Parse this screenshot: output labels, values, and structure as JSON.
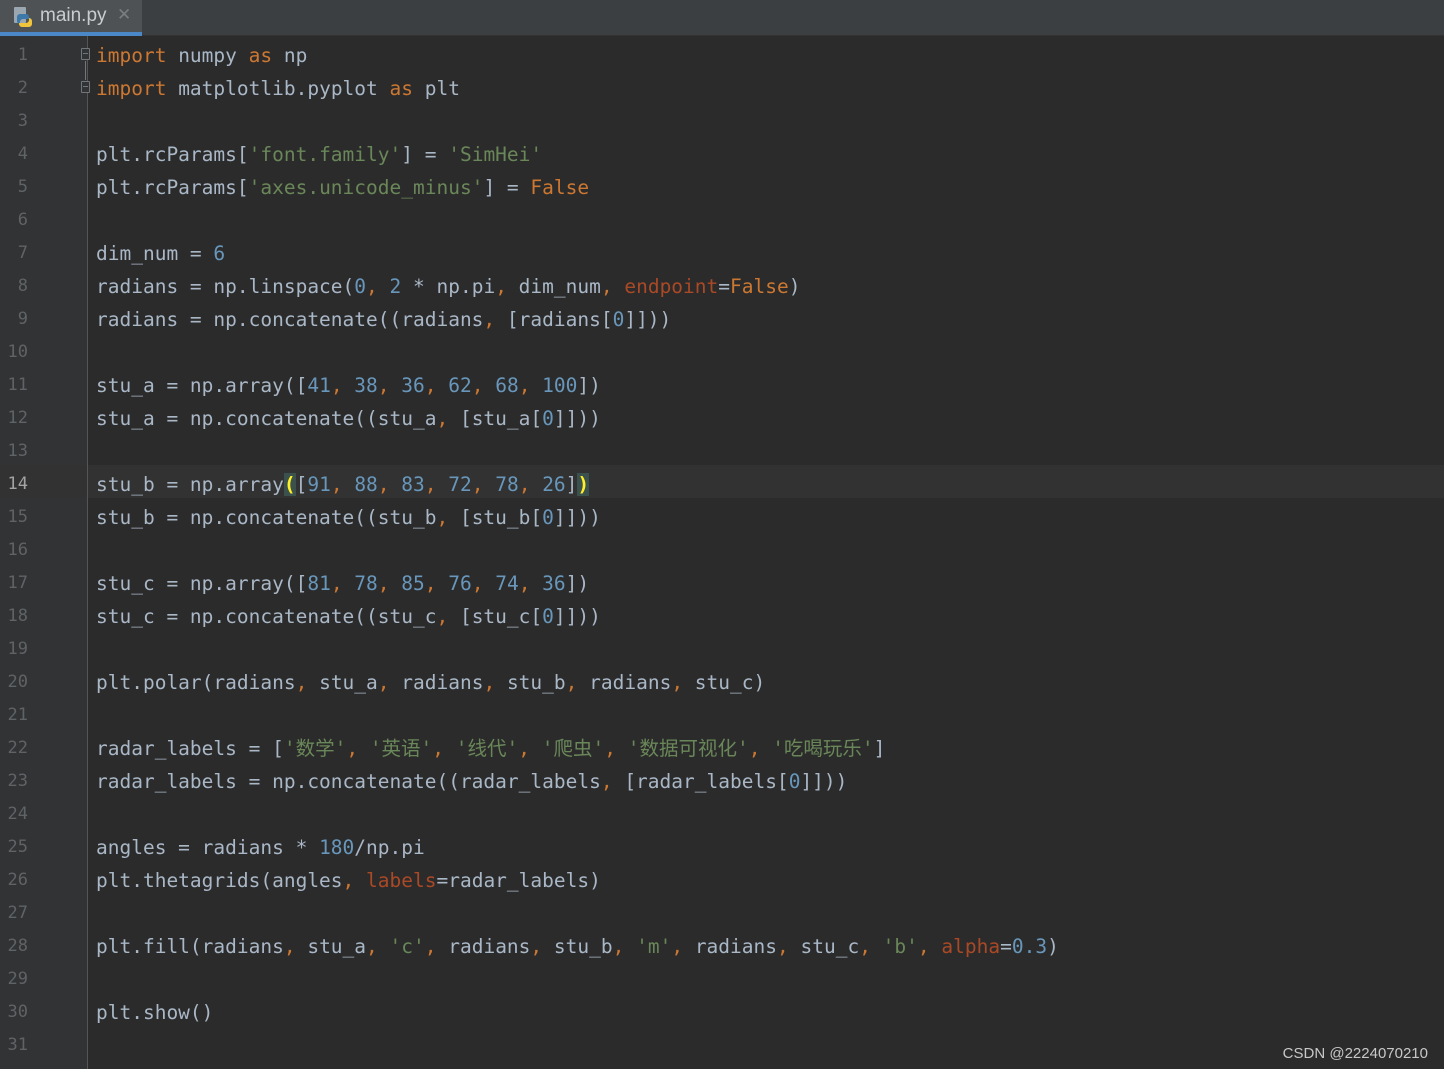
{
  "tab": {
    "filename": "main.py",
    "icon": "python-file-icon",
    "close_glyph": "✕"
  },
  "editor": {
    "current_line": 14,
    "colors": {
      "background": "#2b2b2b",
      "gutter": "#313335",
      "keyword": "#cc7832",
      "string": "#6a8759",
      "number": "#6897bb",
      "param": "#aa4926",
      "default": "#a9b7c6",
      "matched_brace": "#ffef28"
    },
    "lines": [
      {
        "n": "1",
        "tokens": [
          {
            "t": "import",
            "c": "kw"
          },
          {
            "t": " numpy "
          },
          {
            "t": "as",
            "c": "kw"
          },
          {
            "t": " np"
          }
        ]
      },
      {
        "n": "2",
        "tokens": [
          {
            "t": "import",
            "c": "kw"
          },
          {
            "t": " matplotlib.pyplot "
          },
          {
            "t": "as",
            "c": "kw"
          },
          {
            "t": " plt"
          }
        ]
      },
      {
        "n": "3",
        "tokens": []
      },
      {
        "n": "4",
        "tokens": [
          {
            "t": "plt.rcParams["
          },
          {
            "t": "'font.family'",
            "c": "str"
          },
          {
            "t": "] = "
          },
          {
            "t": "'SimHei'",
            "c": "str"
          }
        ]
      },
      {
        "n": "5",
        "tokens": [
          {
            "t": "plt.rcParams["
          },
          {
            "t": "'axes.unicode_minus'",
            "c": "str"
          },
          {
            "t": "] = "
          },
          {
            "t": "False",
            "c": "kw"
          }
        ]
      },
      {
        "n": "6",
        "tokens": []
      },
      {
        "n": "7",
        "tokens": [
          {
            "t": "dim_num = "
          },
          {
            "t": "6",
            "c": "num"
          }
        ]
      },
      {
        "n": "8",
        "tokens": [
          {
            "t": "radians = np.linspace("
          },
          {
            "t": "0",
            "c": "num"
          },
          {
            "t": ", ",
            "c": "kw"
          },
          {
            "t": "2",
            "c": "num"
          },
          {
            "t": " * np.pi"
          },
          {
            "t": ", ",
            "c": "kw"
          },
          {
            "t": "dim_num"
          },
          {
            "t": ", ",
            "c": "kw"
          },
          {
            "t": "endpoint",
            "c": "param"
          },
          {
            "t": "="
          },
          {
            "t": "False",
            "c": "kw"
          },
          {
            "t": ")"
          }
        ]
      },
      {
        "n": "9",
        "tokens": [
          {
            "t": "radians = np.concatenate((radians"
          },
          {
            "t": ", ",
            "c": "kw"
          },
          {
            "t": "[radians["
          },
          {
            "t": "0",
            "c": "num"
          },
          {
            "t": "]]))"
          }
        ]
      },
      {
        "n": "10",
        "tokens": []
      },
      {
        "n": "11",
        "tokens": [
          {
            "t": "stu_a = np.array(["
          },
          {
            "t": "41",
            "c": "num"
          },
          {
            "t": ", ",
            "c": "kw"
          },
          {
            "t": "38",
            "c": "num"
          },
          {
            "t": ", ",
            "c": "kw"
          },
          {
            "t": "36",
            "c": "num"
          },
          {
            "t": ", ",
            "c": "kw"
          },
          {
            "t": "62",
            "c": "num"
          },
          {
            "t": ", ",
            "c": "kw"
          },
          {
            "t": "68",
            "c": "num"
          },
          {
            "t": ", ",
            "c": "kw"
          },
          {
            "t": "100",
            "c": "num"
          },
          {
            "t": "])"
          }
        ]
      },
      {
        "n": "12",
        "tokens": [
          {
            "t": "stu_a = np.concatenate((stu_a"
          },
          {
            "t": ", ",
            "c": "kw"
          },
          {
            "t": "[stu_a["
          },
          {
            "t": "0",
            "c": "num"
          },
          {
            "t": "]]))"
          }
        ]
      },
      {
        "n": "13",
        "tokens": []
      },
      {
        "n": "14",
        "tokens": [
          {
            "t": "stu_b = np.array"
          },
          {
            "t": "(",
            "c": "brace"
          },
          {
            "t": "["
          },
          {
            "t": "91",
            "c": "num"
          },
          {
            "t": ", ",
            "c": "kw"
          },
          {
            "t": "88",
            "c": "num"
          },
          {
            "t": ", ",
            "c": "kw"
          },
          {
            "t": "83",
            "c": "num"
          },
          {
            "t": ", ",
            "c": "kw"
          },
          {
            "t": "72",
            "c": "num"
          },
          {
            "t": ", ",
            "c": "kw"
          },
          {
            "t": "78",
            "c": "num"
          },
          {
            "t": ", ",
            "c": "kw"
          },
          {
            "t": "26",
            "c": "num"
          },
          {
            "t": "]"
          },
          {
            "t": ")",
            "c": "brace"
          }
        ]
      },
      {
        "n": "15",
        "tokens": [
          {
            "t": "stu_b = np.concatenate((stu_b"
          },
          {
            "t": ", ",
            "c": "kw"
          },
          {
            "t": "[stu_b["
          },
          {
            "t": "0",
            "c": "num"
          },
          {
            "t": "]]))"
          }
        ]
      },
      {
        "n": "16",
        "tokens": []
      },
      {
        "n": "17",
        "tokens": [
          {
            "t": "stu_c = np.array(["
          },
          {
            "t": "81",
            "c": "num"
          },
          {
            "t": ", ",
            "c": "kw"
          },
          {
            "t": "78",
            "c": "num"
          },
          {
            "t": ", ",
            "c": "kw"
          },
          {
            "t": "85",
            "c": "num"
          },
          {
            "t": ", ",
            "c": "kw"
          },
          {
            "t": "76",
            "c": "num"
          },
          {
            "t": ", ",
            "c": "kw"
          },
          {
            "t": "74",
            "c": "num"
          },
          {
            "t": ", ",
            "c": "kw"
          },
          {
            "t": "36",
            "c": "num"
          },
          {
            "t": "])"
          }
        ]
      },
      {
        "n": "18",
        "tokens": [
          {
            "t": "stu_c = np.concatenate((stu_c"
          },
          {
            "t": ", ",
            "c": "kw"
          },
          {
            "t": "[stu_c["
          },
          {
            "t": "0",
            "c": "num"
          },
          {
            "t": "]]))"
          }
        ]
      },
      {
        "n": "19",
        "tokens": []
      },
      {
        "n": "20",
        "tokens": [
          {
            "t": "plt.polar(radians"
          },
          {
            "t": ", ",
            "c": "kw"
          },
          {
            "t": "stu_a"
          },
          {
            "t": ", ",
            "c": "kw"
          },
          {
            "t": "radians"
          },
          {
            "t": ", ",
            "c": "kw"
          },
          {
            "t": "stu_b"
          },
          {
            "t": ", ",
            "c": "kw"
          },
          {
            "t": "radians"
          },
          {
            "t": ", ",
            "c": "kw"
          },
          {
            "t": "stu_c)"
          }
        ]
      },
      {
        "n": "21",
        "tokens": []
      },
      {
        "n": "22",
        "tokens": [
          {
            "t": "radar_labels = ["
          },
          {
            "t": "'数学'",
            "c": "str"
          },
          {
            "t": ", ",
            "c": "kw"
          },
          {
            "t": "'英语'",
            "c": "str"
          },
          {
            "t": ", ",
            "c": "kw"
          },
          {
            "t": "'线代'",
            "c": "str"
          },
          {
            "t": ", ",
            "c": "kw"
          },
          {
            "t": "'爬虫'",
            "c": "str"
          },
          {
            "t": ", ",
            "c": "kw"
          },
          {
            "t": "'数据可视化'",
            "c": "str"
          },
          {
            "t": ", ",
            "c": "kw"
          },
          {
            "t": "'吃喝玩乐'",
            "c": "str"
          },
          {
            "t": "]"
          }
        ]
      },
      {
        "n": "23",
        "tokens": [
          {
            "t": "radar_labels = np.concatenate((radar_labels"
          },
          {
            "t": ", ",
            "c": "kw"
          },
          {
            "t": "[radar_labels["
          },
          {
            "t": "0",
            "c": "num"
          },
          {
            "t": "]]))"
          }
        ]
      },
      {
        "n": "24",
        "tokens": []
      },
      {
        "n": "25",
        "tokens": [
          {
            "t": "angles = radians * "
          },
          {
            "t": "180",
            "c": "num"
          },
          {
            "t": "/np.pi"
          }
        ]
      },
      {
        "n": "26",
        "tokens": [
          {
            "t": "plt.thetagrids(angles"
          },
          {
            "t": ", ",
            "c": "kw"
          },
          {
            "t": "labels",
            "c": "param"
          },
          {
            "t": "=radar_labels)"
          }
        ]
      },
      {
        "n": "27",
        "tokens": []
      },
      {
        "n": "28",
        "tokens": [
          {
            "t": "plt.fill(radians"
          },
          {
            "t": ", ",
            "c": "kw"
          },
          {
            "t": "stu_a"
          },
          {
            "t": ", ",
            "c": "kw"
          },
          {
            "t": "'c'",
            "c": "str"
          },
          {
            "t": ", ",
            "c": "kw"
          },
          {
            "t": "radians"
          },
          {
            "t": ", ",
            "c": "kw"
          },
          {
            "t": "stu_b"
          },
          {
            "t": ", ",
            "c": "kw"
          },
          {
            "t": "'m'",
            "c": "str"
          },
          {
            "t": ", ",
            "c": "kw"
          },
          {
            "t": "radians"
          },
          {
            "t": ", ",
            "c": "kw"
          },
          {
            "t": "stu_c"
          },
          {
            "t": ", ",
            "c": "kw"
          },
          {
            "t": "'b'",
            "c": "str"
          },
          {
            "t": ", ",
            "c": "kw"
          },
          {
            "t": "alpha",
            "c": "param"
          },
          {
            "t": "="
          },
          {
            "t": "0.3",
            "c": "num"
          },
          {
            "t": ")"
          }
        ]
      },
      {
        "n": "29",
        "tokens": []
      },
      {
        "n": "30",
        "tokens": [
          {
            "t": "plt.show()"
          }
        ]
      },
      {
        "n": "31",
        "tokens": []
      }
    ]
  },
  "watermark": "CSDN @2224070210"
}
